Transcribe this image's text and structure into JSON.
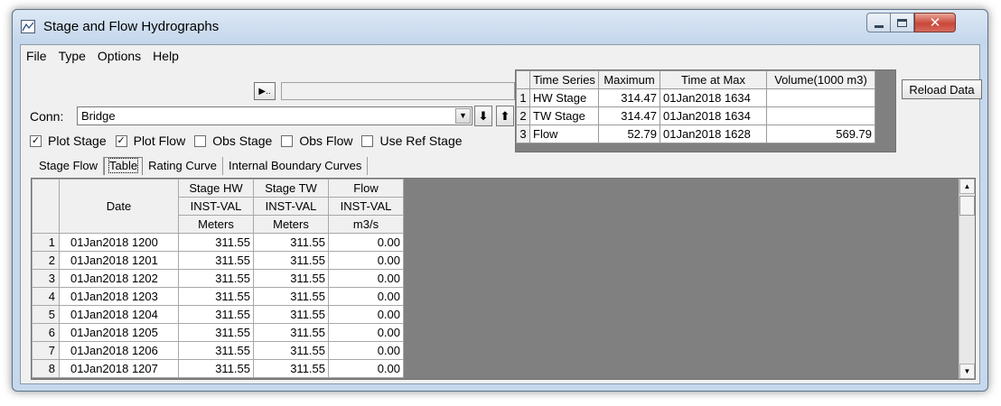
{
  "window": {
    "title": "Stage and Flow Hydrographs"
  },
  "menu": [
    "File",
    "Type",
    "Options",
    "Help"
  ],
  "toolbar": {
    "play_label": "▶..",
    "conn_label": "Conn:",
    "conn_value": "Bridge",
    "down_arrow": "⬇",
    "up_arrow": "⬆",
    "reload_label": "Reload Data"
  },
  "checkboxes": [
    {
      "label": "Plot Stage",
      "checked": true
    },
    {
      "label": "Plot Flow",
      "checked": true
    },
    {
      "label": "Obs Stage",
      "checked": false
    },
    {
      "label": "Obs Flow",
      "checked": false
    },
    {
      "label": "Use Ref Stage",
      "checked": false
    }
  ],
  "summary": {
    "headers": [
      "Time Series",
      "Maximum",
      "Time at Max",
      "Volume(1000 m3)"
    ],
    "rows": [
      {
        "n": "1",
        "series": "HW Stage",
        "max": "314.47",
        "time": "01Jan2018  1634",
        "volume": ""
      },
      {
        "n": "2",
        "series": "TW Stage",
        "max": "314.47",
        "time": "01Jan2018  1634",
        "volume": ""
      },
      {
        "n": "3",
        "series": "Flow",
        "max": "52.79",
        "time": "01Jan2018  1628",
        "volume": "569.79"
      }
    ]
  },
  "tabs": [
    "Stage Flow",
    "Table",
    "Rating Curve",
    "Internal Boundary Curves"
  ],
  "active_tab": "Table",
  "table": {
    "date_header": "Date",
    "columns": [
      {
        "name": "Stage HW",
        "type": "INST-VAL",
        "units": "Meters"
      },
      {
        "name": "Stage TW",
        "type": "INST-VAL",
        "units": "Meters"
      },
      {
        "name": "Flow",
        "type": "INST-VAL",
        "units": "m3/s"
      }
    ],
    "rows": [
      {
        "n": "1",
        "date": "01Jan2018  1200",
        "hw": "311.55",
        "tw": "311.55",
        "flow": "0.00"
      },
      {
        "n": "2",
        "date": "01Jan2018  1201",
        "hw": "311.55",
        "tw": "311.55",
        "flow": "0.00"
      },
      {
        "n": "3",
        "date": "01Jan2018  1202",
        "hw": "311.55",
        "tw": "311.55",
        "flow": "0.00"
      },
      {
        "n": "4",
        "date": "01Jan2018  1203",
        "hw": "311.55",
        "tw": "311.55",
        "flow": "0.00"
      },
      {
        "n": "5",
        "date": "01Jan2018  1204",
        "hw": "311.55",
        "tw": "311.55",
        "flow": "0.00"
      },
      {
        "n": "6",
        "date": "01Jan2018  1205",
        "hw": "311.55",
        "tw": "311.55",
        "flow": "0.00"
      },
      {
        "n": "7",
        "date": "01Jan2018  1206",
        "hw": "311.55",
        "tw": "311.55",
        "flow": "0.00"
      },
      {
        "n": "8",
        "date": "01Jan2018  1207",
        "hw": "311.55",
        "tw": "311.55",
        "flow": "0.00"
      }
    ]
  }
}
